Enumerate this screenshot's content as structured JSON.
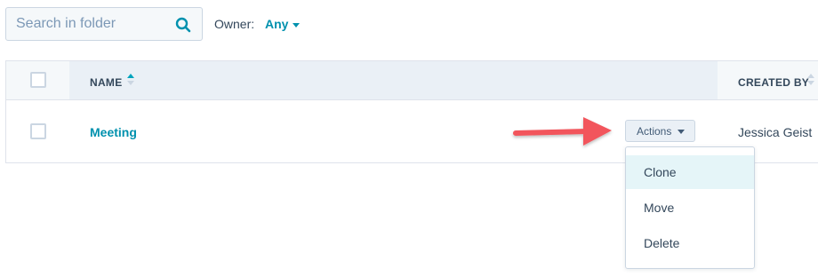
{
  "search": {
    "placeholder": "Search in folder",
    "icon": "search-icon"
  },
  "filter": {
    "owner_label": "Owner:",
    "owner_value": "Any"
  },
  "table": {
    "columns": {
      "name": "NAME",
      "created_by": "CREATED BY"
    },
    "sort": {
      "column": "name",
      "direction": "ascending"
    },
    "rows": [
      {
        "name": "Meeting",
        "created_by": "Jessica Geist"
      }
    ]
  },
  "actions": {
    "label": "Actions",
    "menu": [
      "Clone",
      "Move",
      "Delete"
    ],
    "highlighted": "Clone"
  },
  "colors": {
    "accent": "#0091ae",
    "arrow": "#f2545b",
    "header_bg": "#f5f8fa",
    "hover_bg": "#e5f5f8"
  }
}
